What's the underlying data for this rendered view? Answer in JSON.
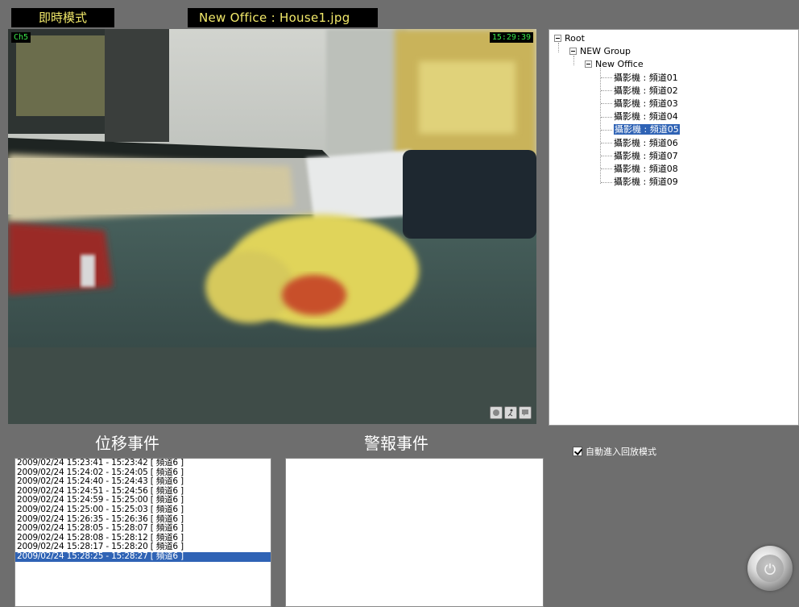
{
  "header": {
    "mode": "即時模式",
    "file": "New Office : House1.jpg"
  },
  "video": {
    "channel": "Ch5",
    "time": "15:29:39",
    "icons": [
      "snapshot-icon",
      "motion-icon",
      "chat-icon"
    ]
  },
  "tree": {
    "root": "Root",
    "group": "NEW Group",
    "office": "New Office",
    "cameras": [
      "攝影機 : 頻道01",
      "攝影機 : 頻道02",
      "攝影機 : 頻道03",
      "攝影機 : 頻道04",
      "攝影機 : 頻道05",
      "攝影機 : 頻道06",
      "攝影機 : 頻道07",
      "攝影機 : 頻道08",
      "攝影機 : 頻道09"
    ],
    "selected_index": 4
  },
  "motion": {
    "title": "位移事件",
    "events": [
      "2009/02/24  15:23:41 - 15:23:42 [ 頻道6 ]",
      "2009/02/24  15:24:02 - 15:24:05 [ 頻道6 ]",
      "2009/02/24  15:24:40 - 15:24:43 [ 頻道6 ]",
      "2009/02/24  15:24:51 - 15:24:56 [ 頻道6 ]",
      "2009/02/24  15:24:59 - 15:25:00 [ 頻道6 ]",
      "2009/02/24  15:25:00 - 15:25:03 [ 頻道6 ]",
      "2009/02/24  15:26:35 - 15:26:36 [ 頻道6 ]",
      "2009/02/24  15:28:05 - 15:28:07 [ 頻道6 ]",
      "2009/02/24  15:28:08 - 15:28:12 [ 頻道6 ]",
      "2009/02/24  15:28:17 - 15:28:20 [ 頻道6 ]",
      "2009/02/24  15:28:25 - 15:28:27 [ 頻道6 ]"
    ],
    "selected_index": 10
  },
  "alarm": {
    "title": "警報事件",
    "events": []
  },
  "options": {
    "auto_playback_label": "自動進入回放模式",
    "auto_playback_checked": true
  },
  "colors": {
    "selection": "#2f63b5",
    "label_text": "#f2e96a",
    "osd_text": "#39e64a"
  }
}
